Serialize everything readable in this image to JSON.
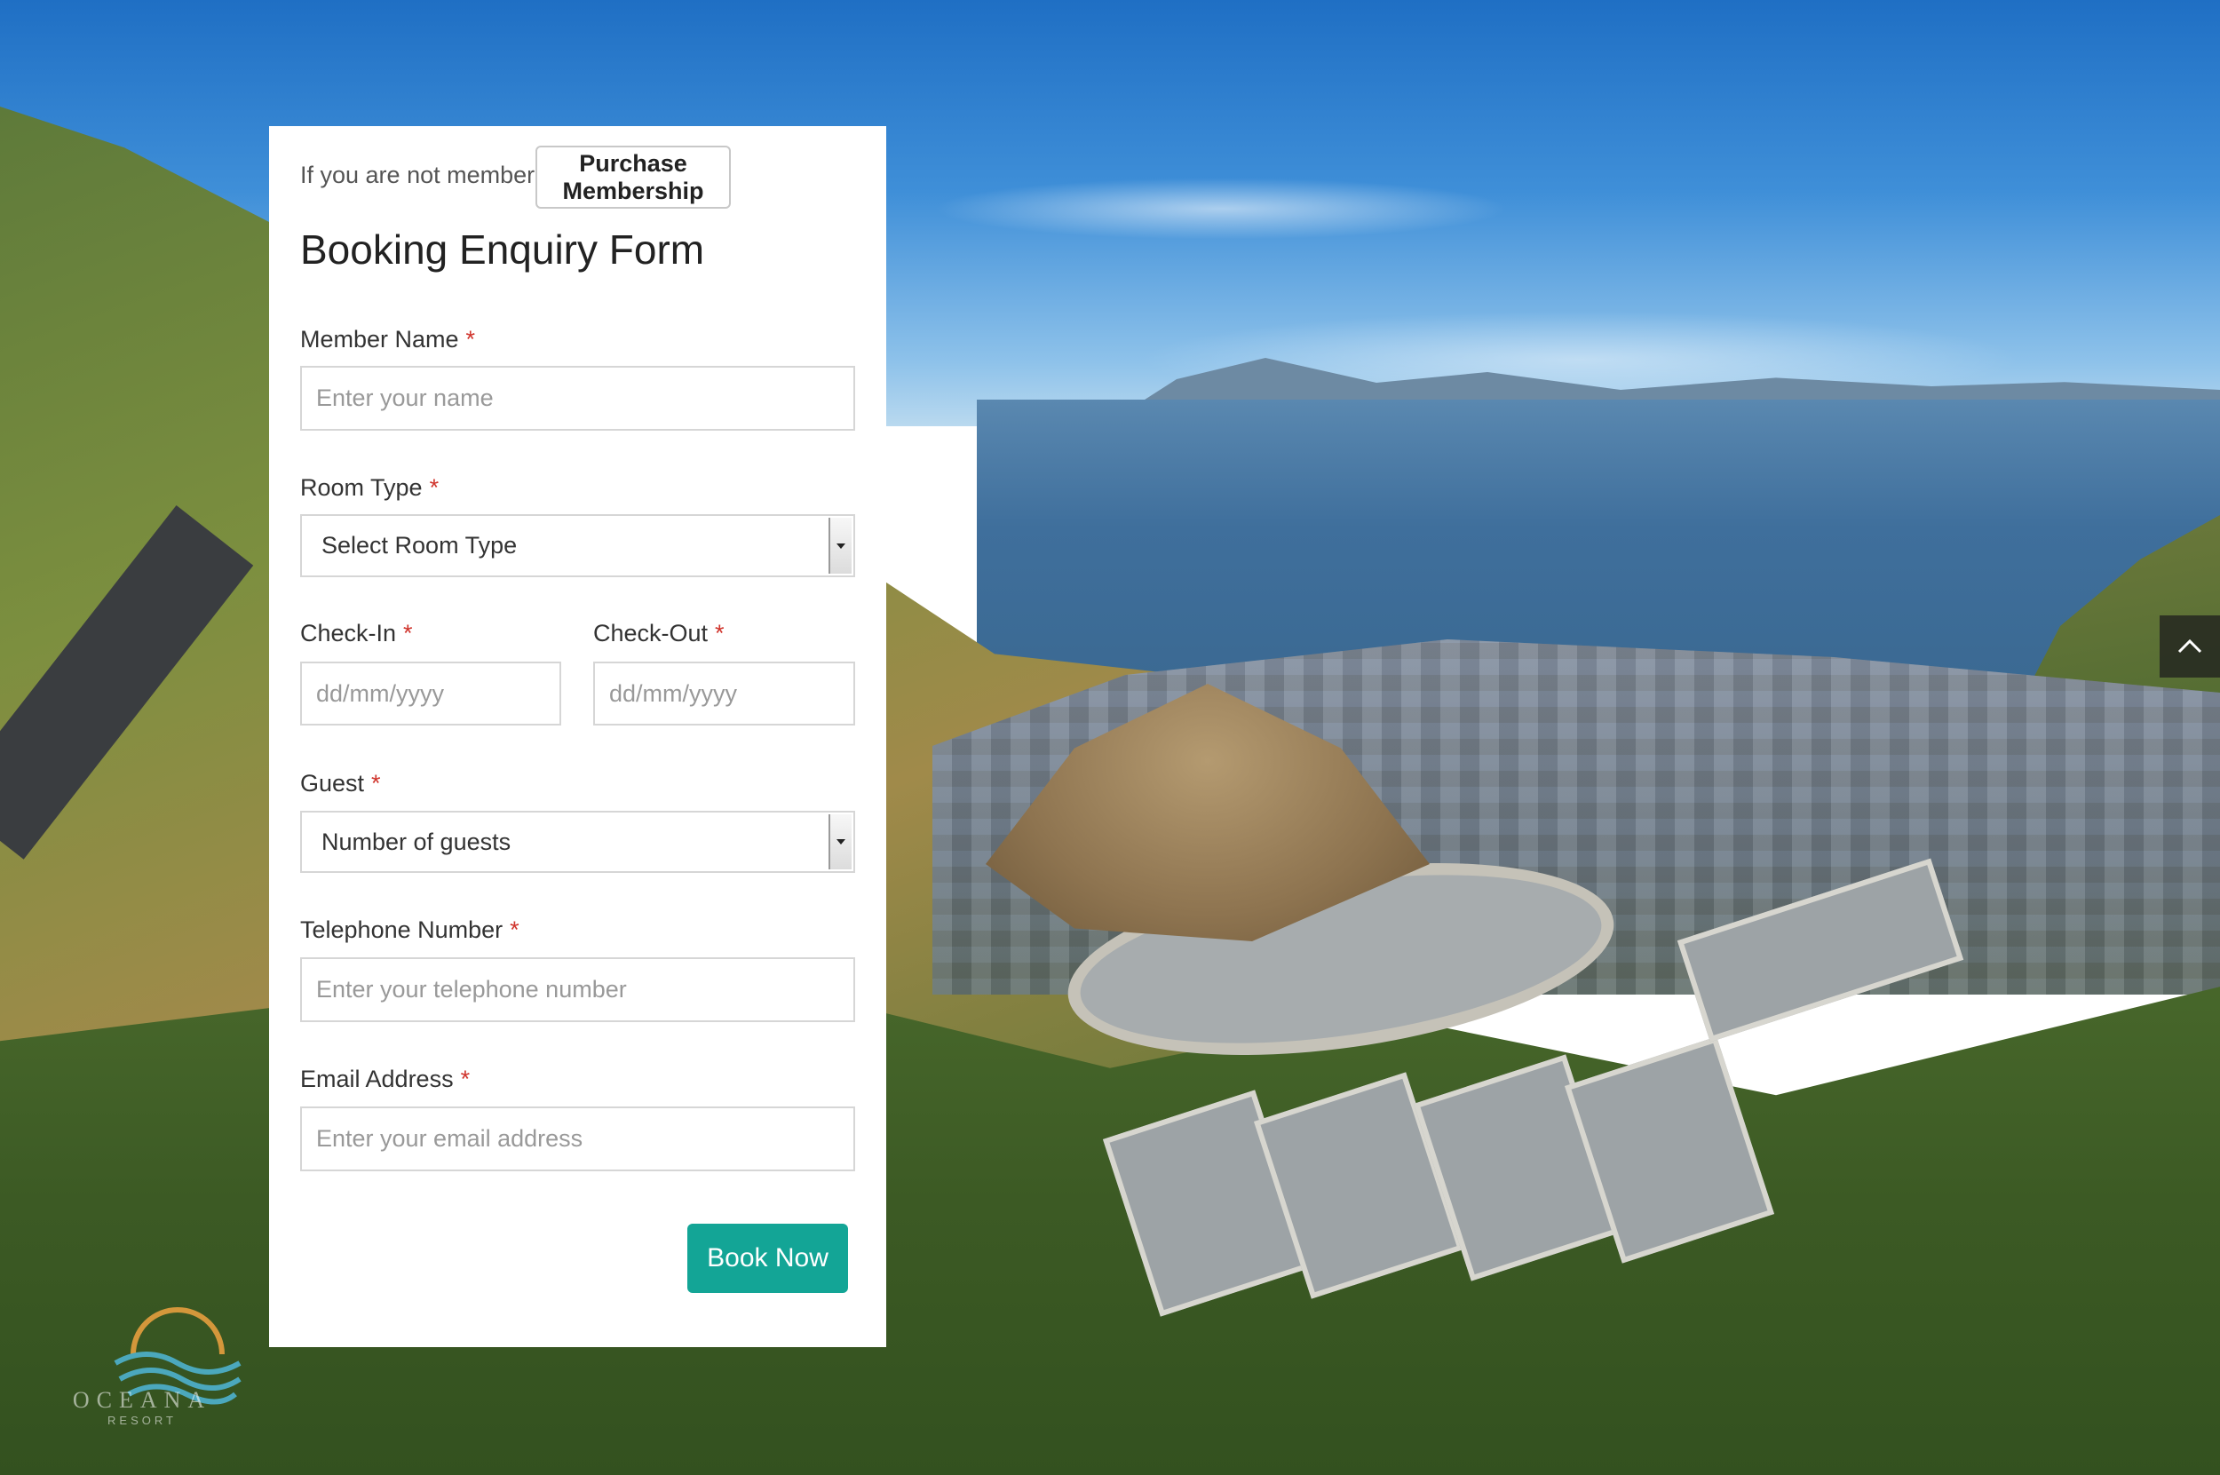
{
  "membership": {
    "prompt": "If you are not member",
    "button_label": "Purchase Membership"
  },
  "form": {
    "title": "Booking Enquiry Form",
    "required_marker": "*",
    "fields": {
      "member_name": {
        "label": "Member Name",
        "placeholder": "Enter your name"
      },
      "room_type": {
        "label": "Room Type",
        "selected": "Select Room Type"
      },
      "check_in": {
        "label": "Check-In",
        "placeholder": "dd/mm/yyyy"
      },
      "check_out": {
        "label": "Check-Out",
        "placeholder": "dd/mm/yyyy"
      },
      "guest": {
        "label": "Guest",
        "selected": "Number of guests"
      },
      "telephone": {
        "label": "Telephone Number",
        "placeholder": "Enter your telephone number"
      },
      "email": {
        "label": "Email Address",
        "placeholder": "Enter your email address"
      }
    },
    "submit_label": "Book Now"
  },
  "branding": {
    "logo_text": "OCEANA",
    "logo_subtext": "RESORT"
  },
  "icons": {
    "scroll_top": "chevron-up-icon",
    "select_arrow": "caret-down-icon"
  },
  "colors": {
    "accent": "#13a596",
    "required": "#d0342c",
    "card_background": "#ffffff"
  }
}
